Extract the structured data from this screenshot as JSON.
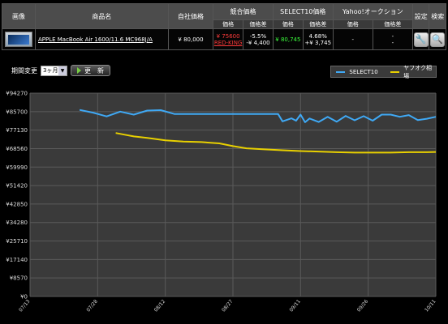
{
  "header": {
    "image": "画像",
    "product_name": "商品名",
    "own_price": "自社価格",
    "competitor": "競合価格",
    "select10": "SELECT10価格",
    "yahoo": "Yahoo!オークション",
    "settings": "設定",
    "search": "検索",
    "sub_price": "価格",
    "sub_diff": "価格差"
  },
  "product": {
    "name": "APPLE MacBook Air 1600/11.6 MC968J/A",
    "own_price": "¥ 80,000",
    "competitor_price": "¥ 75600",
    "competitor_shop": "RED-KING",
    "competitor_diff_pct": "-5.5%",
    "competitor_diff_yen": "-¥ 4,400",
    "select10_price": "¥ 80,745",
    "select10_diff_pct": "4.68%",
    "select10_diff_yen": "+¥ 3,745",
    "yahoo_price": "-",
    "yahoo_diff_1": "-",
    "yahoo_diff_2": "-",
    "settings_icon": "wrench-icon",
    "search_icon": "magnifier-icon"
  },
  "controls": {
    "period_label": "期間変更",
    "period_value": "3ヶ月",
    "update_button": "更　新"
  },
  "legend": {
    "series1": "SELECT10",
    "series1_color": "#3fa9f5",
    "series2": "ヤフオク相場",
    "series2_color": "#e8d000"
  },
  "chart_data": {
    "type": "line",
    "grid": true,
    "y_ticks": [
      "¥0",
      "¥8570",
      "¥17140",
      "¥25710",
      "¥34280",
      "¥42850",
      "¥51420",
      "¥59990",
      "¥68560",
      "¥77130",
      "¥85700",
      "¥94270"
    ],
    "x_ticks": [
      "07/13",
      "07/28",
      "08/12",
      "08/27",
      "09/11",
      "09/26",
      "10/11"
    ],
    "ylim": [
      0,
      94270
    ],
    "series": [
      {
        "name": "SELECT10",
        "color": "#3fa9f5",
        "x": [
          "07/24",
          "07/27",
          "07/30",
          "08/02",
          "08/05",
          "08/08",
          "08/11",
          "08/14",
          "08/17",
          "08/20",
          "08/23",
          "08/26",
          "08/29",
          "09/01",
          "09/04",
          "09/06",
          "09/07",
          "09/09",
          "09/10",
          "09/11",
          "09/12",
          "09/13",
          "09/15",
          "09/17",
          "09/19",
          "09/21",
          "09/23",
          "09/25",
          "09/27",
          "09/29",
          "10/01",
          "10/03",
          "10/05",
          "10/07",
          "10/09",
          "10/11"
        ],
        "values": [
          86500,
          85200,
          83500,
          85700,
          84300,
          86200,
          86400,
          84600,
          84600,
          84600,
          84600,
          84600,
          84600,
          84600,
          84600,
          84600,
          81200,
          82600,
          81500,
          84300,
          80800,
          82500,
          80900,
          83300,
          81000,
          83700,
          81700,
          83600,
          81500,
          84300,
          84300,
          83300,
          84100,
          81800,
          82400,
          83300
        ]
      },
      {
        "name": "ヤフオク相場",
        "color": "#e8d000",
        "x": [
          "08/01",
          "08/03",
          "08/05",
          "08/08",
          "08/12",
          "08/16",
          "08/20",
          "08/24",
          "08/27",
          "08/30",
          "09/03",
          "09/07",
          "09/11",
          "09/15",
          "09/19",
          "09/23",
          "09/27",
          "10/01",
          "10/05",
          "10/09",
          "10/11"
        ],
        "values": [
          75800,
          75000,
          74200,
          73500,
          72400,
          71800,
          71600,
          71000,
          69700,
          68700,
          68200,
          67800,
          67400,
          67200,
          66900,
          66700,
          66700,
          66700,
          66900,
          66900,
          67000
        ]
      }
    ]
  }
}
